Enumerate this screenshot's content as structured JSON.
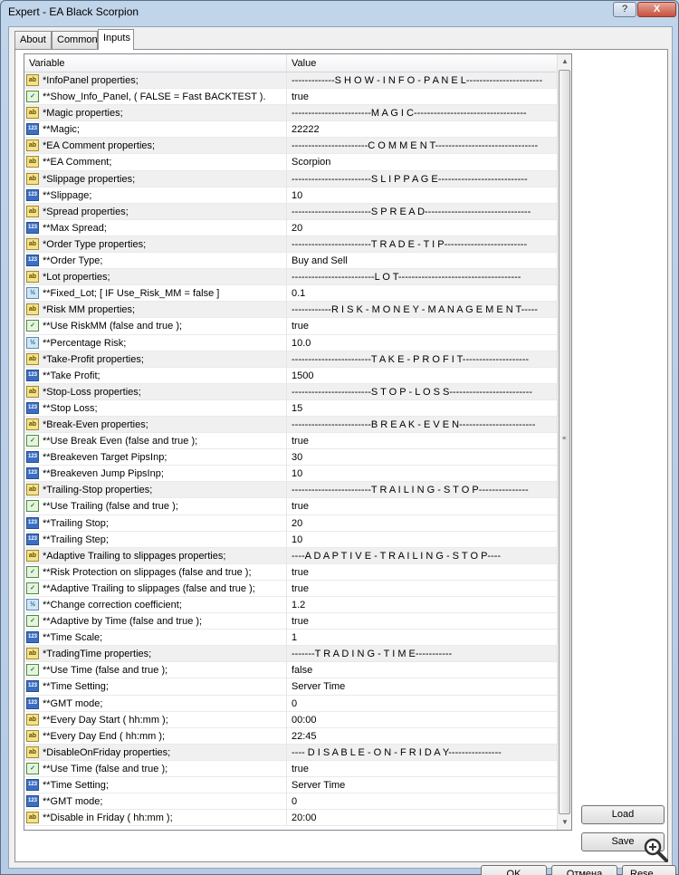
{
  "window": {
    "title": "Expert - EA Black Scorpion",
    "help_label": "?",
    "close_label": "X"
  },
  "tabs": [
    {
      "label": "About"
    },
    {
      "label": "Common"
    },
    {
      "label": "Inputs"
    }
  ],
  "grid": {
    "header_variable": "Variable",
    "header_value": "Value"
  },
  "rows": [
    {
      "type": "str",
      "variable": "*InfoPanel properties;",
      "value": "-------------S H O W - I N F O - P A N E L-----------------------"
    },
    {
      "type": "bool",
      "variable": "**Show_Info_Panel, ( FALSE = Fast BACKTEST ).",
      "value": "true"
    },
    {
      "type": "str",
      "variable": "*Magic properties;",
      "value": "------------------------M A G I C----------------------------------"
    },
    {
      "type": "int",
      "variable": "**Magic;",
      "value": "22222"
    },
    {
      "type": "str",
      "variable": "*EA Comment properties;",
      "value": "-----------------------C O M M E N T-------------------------------"
    },
    {
      "type": "str",
      "variable": "**EA Comment;",
      "value": "Scorpion"
    },
    {
      "type": "str",
      "variable": "*Slippage properties;",
      "value": "------------------------S L I P P A G E---------------------------"
    },
    {
      "type": "int",
      "variable": "**Slippage;",
      "value": "10"
    },
    {
      "type": "str",
      "variable": "*Spread properties;",
      "value": "------------------------S P R E A D--------------------------------"
    },
    {
      "type": "int",
      "variable": "**Max Spread;",
      "value": "20"
    },
    {
      "type": "str",
      "variable": "*Order Type properties;",
      "value": "------------------------T R A D E - T I P-------------------------"
    },
    {
      "type": "int",
      "variable": "**Order Type;",
      "value": "Buy and Sell"
    },
    {
      "type": "str",
      "variable": "*Lot properties;",
      "value": "-------------------------L O T-------------------------------------"
    },
    {
      "type": "dbl",
      "variable": "**Fixed_Lot; [ IF  Use_Risk_MM = false ]",
      "value": "0.1"
    },
    {
      "type": "str",
      "variable": "*Risk MM properties;",
      "value": "------------R I S K - M O N E Y - M A N A G E M E N T-----"
    },
    {
      "type": "bool",
      "variable": "**Use RiskMM (false and true );",
      "value": "true"
    },
    {
      "type": "dbl",
      "variable": "**Percentage Risk;",
      "value": "10.0"
    },
    {
      "type": "str",
      "variable": "*Take-Profit properties;",
      "value": "------------------------T A K E - P R O F I T--------------------"
    },
    {
      "type": "int",
      "variable": "**Take Profit;",
      "value": "1500"
    },
    {
      "type": "str",
      "variable": "*Stop-Loss properties;",
      "value": "------------------------S T O P - L O S S-------------------------"
    },
    {
      "type": "int",
      "variable": "**Stop Loss;",
      "value": "15"
    },
    {
      "type": "str",
      "variable": "*Break-Even properties;",
      "value": "------------------------B R E A K - E V E N-----------------------"
    },
    {
      "type": "bool",
      "variable": "**Use Break Even (false and true );",
      "value": "true"
    },
    {
      "type": "int",
      "variable": "**Breakeven Target PipsInp;",
      "value": "30"
    },
    {
      "type": "int",
      "variable": "**Breakeven Jump PipsInp;",
      "value": "10"
    },
    {
      "type": "str",
      "variable": "*Trailing-Stop properties;",
      "value": "------------------------T R A I L I N G - S T O P---------------"
    },
    {
      "type": "bool",
      "variable": "**Use Trailing (false and true );",
      "value": "true"
    },
    {
      "type": "int",
      "variable": "**Trailing Stop;",
      "value": "20"
    },
    {
      "type": "int",
      "variable": "**Trailing Step;",
      "value": "10"
    },
    {
      "type": "str",
      "variable": "*Adaptive Trailing to slippages properties;",
      "value": "----A D A P T I V E - T R A I L I N G - S T O P----"
    },
    {
      "type": "bool",
      "variable": "**Risk Protection on slippages (false and true );",
      "value": "true"
    },
    {
      "type": "bool",
      "variable": "**Adaptive Trailing to slippages (false and true );",
      "value": "true"
    },
    {
      "type": "dbl",
      "variable": "**Change correction coefficient;",
      "value": "1.2"
    },
    {
      "type": "bool",
      "variable": "**Adaptive by Time (false and true );",
      "value": "true"
    },
    {
      "type": "int",
      "variable": "**Time Scale;",
      "value": "1"
    },
    {
      "type": "str",
      "variable": "*TradingTime properties;",
      "value": "-------T R A D I N G - T I M E-----------"
    },
    {
      "type": "bool",
      "variable": "**Use Time (false and true );",
      "value": "false"
    },
    {
      "type": "int",
      "variable": "**Time Setting;",
      "value": "Server Time"
    },
    {
      "type": "int",
      "variable": "**GMT mode;",
      "value": "0"
    },
    {
      "type": "str",
      "variable": "**Every Day Start ( hh:mm );",
      "value": "00:00"
    },
    {
      "type": "str",
      "variable": "**Every Day End ( hh:mm );",
      "value": "22:45"
    },
    {
      "type": "str",
      "variable": "*DisableOnFriday properties;",
      "value": "---- D I S A B L E - O N - F R I D A Y----------------"
    },
    {
      "type": "bool",
      "variable": "**Use Time (false and true );",
      "value": "true"
    },
    {
      "type": "int",
      "variable": "**Time Setting;",
      "value": "Server Time"
    },
    {
      "type": "int",
      "variable": "**GMT mode;",
      "value": "0"
    },
    {
      "type": "str",
      "variable": "**Disable in Friday ( hh:mm );",
      "value": "20:00"
    }
  ],
  "icons": {
    "str": "ab",
    "int": "123",
    "dbl": "½",
    "bool": "✓"
  },
  "scroll": {
    "up": "▲",
    "down": "▼",
    "grip": "≡"
  },
  "buttons": {
    "load": "Load",
    "save": "Save",
    "ok": "OK",
    "cancel": "Отмена",
    "reset": "Rese"
  }
}
